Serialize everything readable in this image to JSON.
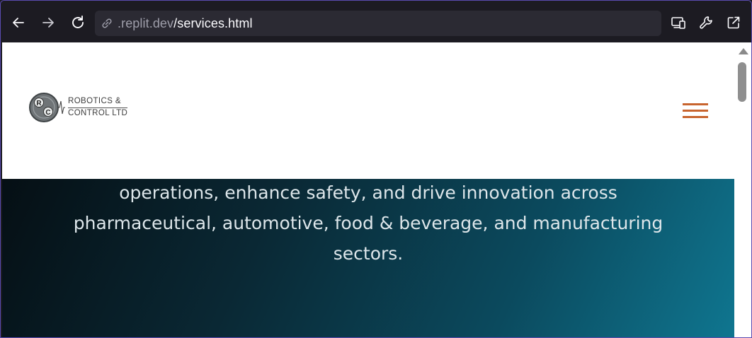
{
  "browser": {
    "url_host": ".replit.dev",
    "url_path": "/services.html",
    "icons": {
      "back": "arrow-left-icon",
      "forward": "arrow-right-icon",
      "reload": "reload-icon",
      "link": "link-icon",
      "devices": "devices-icon",
      "tools": "wrench-icon",
      "open_external": "open-external-icon"
    }
  },
  "header": {
    "logo": {
      "monogram": "RC",
      "line1": "ROBOTICS &",
      "line2": "CONTROL LTD"
    },
    "menu_icon": "hamburger-menu-icon",
    "accent_color": "#c8642e"
  },
  "hero": {
    "lines": [
      "operations, enhance safety, and drive innovation across",
      "pharmaceutical, automotive, food & beverage, and manufacturing",
      "sectors."
    ]
  }
}
